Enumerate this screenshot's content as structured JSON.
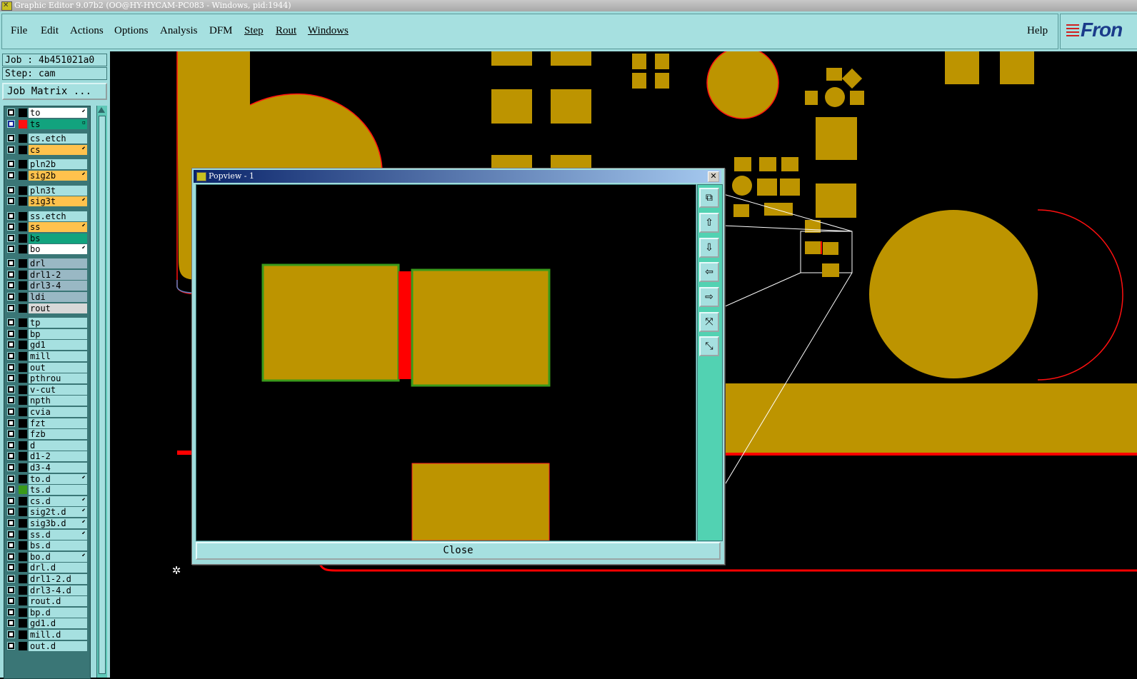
{
  "window_title": "Graphic Editor 9.07b2 (OO@HY-HYCAM-PC083 - Windows, pid:1944)",
  "menu": [
    "File",
    "Edit",
    "Actions",
    "Options",
    "Analysis",
    "DFM",
    "Step",
    "Rout",
    "Windows"
  ],
  "help_label": "Help",
  "logo_text": "Fron",
  "job": {
    "line": "Job : 4b451021a0",
    "step": "Step: cam",
    "matrix_button": "Job Matrix ..."
  },
  "layers": [
    {
      "name": "to",
      "color": "#ffffff",
      "mark": "⬋"
    },
    {
      "name": "ts",
      "color": "#12a37e",
      "mark": "▫",
      "active": true
    },
    {
      "name": "cs.etch",
      "color": "#a6e0e0",
      "mark": ""
    },
    {
      "name": "cs",
      "color": "#ffc24d",
      "mark": "⬋"
    },
    {
      "name": "pln2b",
      "color": "#a6e0e0",
      "mark": ""
    },
    {
      "name": "sig2b",
      "color": "#ffc24d",
      "mark": "⬋"
    },
    {
      "name": "pln3t",
      "color": "#a6e0e0",
      "mark": ""
    },
    {
      "name": "sig3t",
      "color": "#ffc24d",
      "mark": "⬋"
    },
    {
      "name": "ss.etch",
      "color": "#a6e0e0",
      "mark": ""
    },
    {
      "name": "ss",
      "color": "#ffc24d",
      "mark": "⬋"
    },
    {
      "name": "bs",
      "color": "#12a37e",
      "mark": ""
    },
    {
      "name": "bo",
      "color": "#ffffff",
      "mark": "⬋"
    },
    {
      "name": "drl",
      "color": "#99b8c4",
      "mark": ""
    },
    {
      "name": "drl1-2",
      "color": "#99b8c4",
      "mark": ""
    },
    {
      "name": "drl3-4",
      "color": "#99b8c4",
      "mark": ""
    },
    {
      "name": "ldi",
      "color": "#99b8c4",
      "mark": ""
    },
    {
      "name": "rout",
      "color": "#d8d8d8",
      "mark": ""
    },
    {
      "name": "tp",
      "color": "#a6e0e0",
      "mark": ""
    },
    {
      "name": "bp",
      "color": "#a6e0e0",
      "mark": ""
    },
    {
      "name": "gd1",
      "color": "#a6e0e0",
      "mark": ""
    },
    {
      "name": "mill",
      "color": "#a6e0e0",
      "mark": ""
    },
    {
      "name": "out",
      "color": "#a6e0e0",
      "mark": ""
    },
    {
      "name": "pthrou",
      "color": "#a6e0e0",
      "mark": ""
    },
    {
      "name": "v-cut",
      "color": "#a6e0e0",
      "mark": ""
    },
    {
      "name": "npth",
      "color": "#a6e0e0",
      "mark": ""
    },
    {
      "name": "cvia",
      "color": "#a6e0e0",
      "mark": ""
    },
    {
      "name": "fzt",
      "color": "#a6e0e0",
      "mark": ""
    },
    {
      "name": "fzb",
      "color": "#a6e0e0",
      "mark": ""
    },
    {
      "name": "d",
      "color": "#a6e0e0",
      "mark": ""
    },
    {
      "name": "d1-2",
      "color": "#a6e0e0",
      "mark": ""
    },
    {
      "name": "d3-4",
      "color": "#a6e0e0",
      "mark": ""
    },
    {
      "name": "to.d",
      "color": "#a6e0e0",
      "mark": "⬋"
    },
    {
      "name": "ts.d",
      "color": "#a6e0e0",
      "mark": ""
    },
    {
      "name": "cs.d",
      "color": "#a6e0e0",
      "mark": "⬋"
    },
    {
      "name": "sig2t.d",
      "color": "#a6e0e0",
      "mark": "⬋"
    },
    {
      "name": "sig3b.d",
      "color": "#a6e0e0",
      "mark": "⬋"
    },
    {
      "name": "ss.d",
      "color": "#a6e0e0",
      "mark": "⬋"
    },
    {
      "name": "bs.d",
      "color": "#a6e0e0",
      "mark": ""
    },
    {
      "name": "bo.d",
      "color": "#a6e0e0",
      "mark": "⬋"
    },
    {
      "name": "drl.d",
      "color": "#a6e0e0",
      "mark": ""
    },
    {
      "name": "drl1-2.d",
      "color": "#a6e0e0",
      "mark": ""
    },
    {
      "name": "drl3-4.d",
      "color": "#a6e0e0",
      "mark": ""
    },
    {
      "name": "rout.d",
      "color": "#a6e0e0",
      "mark": ""
    },
    {
      "name": "bp.d",
      "color": "#a6e0e0",
      "mark": ""
    },
    {
      "name": "gd1.d",
      "color": "#a6e0e0",
      "mark": ""
    },
    {
      "name": "mill.d",
      "color": "#a6e0e0",
      "mark": ""
    },
    {
      "name": "out.d",
      "color": "#a6e0e0",
      "mark": ""
    }
  ],
  "popview": {
    "title": "Popview - 1",
    "close_label": "Close"
  },
  "colors": {
    "copper": "#bd9400",
    "outline_red": "#ff0000",
    "outline_green": "#3a9a1a",
    "panel": "#9fdcdc"
  }
}
